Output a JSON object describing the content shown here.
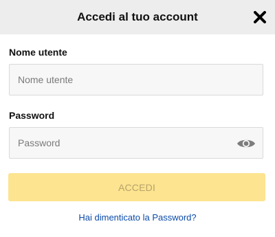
{
  "header": {
    "title": "Accedi al tuo account",
    "close_icon": "close-x-icon"
  },
  "form": {
    "username": {
      "label": "Nome utente",
      "placeholder": "Nome utente",
      "value": ""
    },
    "password": {
      "label": "Password",
      "placeholder": "Password",
      "value": "",
      "toggle_icon": "eye-icon"
    },
    "submit_label": "ACCEDI",
    "forgot_link": "Hai dimenticato la Password?"
  },
  "colors": {
    "header_bg": "#ededed",
    "submit_bg": "#fce490",
    "submit_text": "#b8a26a",
    "link": "#0a4aa8",
    "field_bg": "#f7f7f7"
  }
}
